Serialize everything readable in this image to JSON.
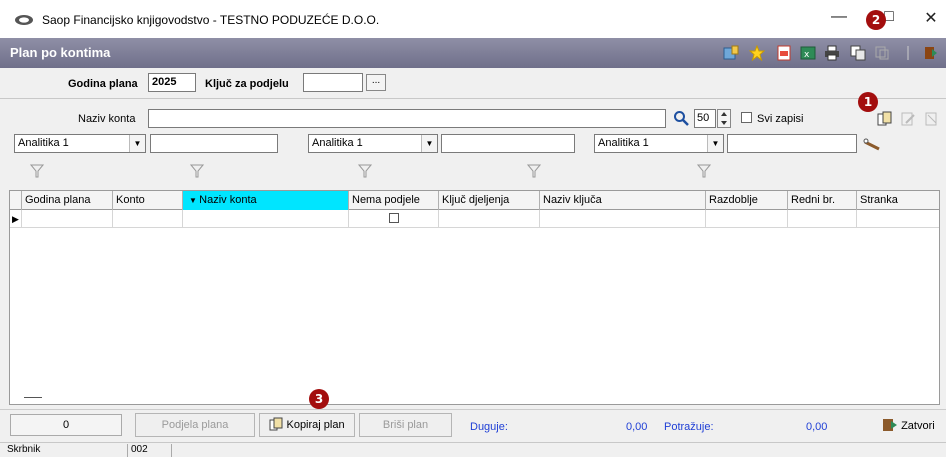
{
  "window": {
    "title": "Saop Financijsko knjigovodstvo - TESTNO PODUZEĆE D.O.O.",
    "minimize_glyph": "—",
    "restore_glyph": "□",
    "close_glyph": "✕"
  },
  "header": {
    "title": "Plan po kontima"
  },
  "badges": {
    "one": "1",
    "two": "2",
    "three": "3"
  },
  "top_form": {
    "godina_label": "Godina plana",
    "godina_value": "2025",
    "kljuc_label": "Ključ za podjelu",
    "kljuc_value": "",
    "ellipsis": "..."
  },
  "search": {
    "naziv_label": "Naziv konta",
    "naziv_value": "",
    "count_value": "50",
    "svi_label": "Svi zapisi"
  },
  "analitika": [
    {
      "label": "Analitika 1",
      "value": ""
    },
    {
      "label": "Analitika 1",
      "value": ""
    },
    {
      "label": "Analitika 1",
      "value": ""
    }
  ],
  "grid": {
    "columns": [
      "Godina plana",
      "Konto",
      "Naziv konta",
      "Nema podjele",
      "Ključ djeljenja",
      "Naziv ključa",
      "Razdoblje",
      "Redni br.",
      "Stranka"
    ],
    "sorted_column": "Naziv konta",
    "row_marker": "▶"
  },
  "bottom": {
    "counter": "0",
    "podjela_label": "Podjela plana",
    "kopiraj_label": "Kopiraj plan",
    "brisi_label": "Briši plan",
    "duguje_label": "Duguje:",
    "duguje_value": "0,00",
    "potrazuje_label": "Potražuje:",
    "potrazuje_value": "0,00",
    "zatvori_label": "Zatvori"
  },
  "status": {
    "user": "Skrbnik",
    "code": "002"
  },
  "colors": {
    "header_bg": "#7f7f99",
    "sorted_col": "#00e5ff",
    "badge": "#a30e0e",
    "amount": "#1f3fd6"
  }
}
